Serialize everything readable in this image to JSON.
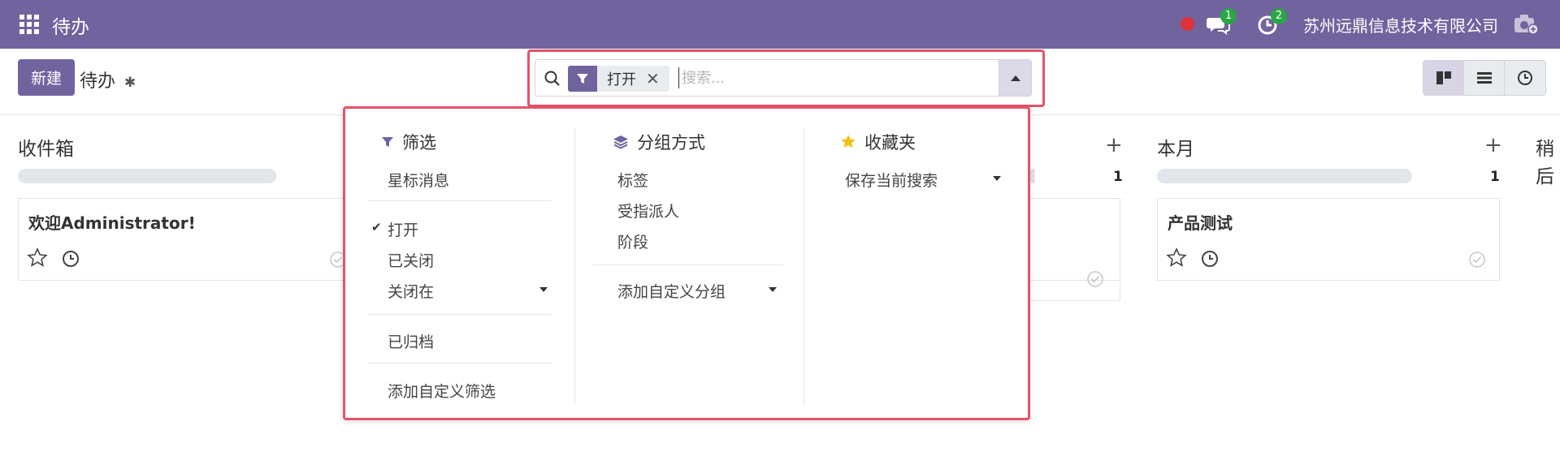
{
  "navbar": {
    "app_title": "待办",
    "chat_badge": "1",
    "activity_badge": "2",
    "company": "苏州远鼎信息技术有限公司",
    "bg_color": "#71639e"
  },
  "control": {
    "new_label": "新建",
    "breadcrumb": "待办"
  },
  "search": {
    "facet_label": "打开",
    "placeholder": "搜索..."
  },
  "dropdown": {
    "filter": {
      "title": "筛选",
      "items": [
        "星标消息",
        "打开",
        "已关闭",
        "关闭在",
        "已归档",
        "添加自定义筛选"
      ],
      "checked": "打开"
    },
    "groupby": {
      "title": "分组方式",
      "items": [
        "标签",
        "受指派人",
        "阶段",
        "添加自定义分组"
      ]
    },
    "favorites": {
      "title": "收藏夹",
      "items": [
        "保存当前搜索"
      ]
    }
  },
  "kanban": {
    "columns": [
      {
        "title": "收件箱",
        "count": "",
        "card": "欢迎Administrator!"
      },
      {
        "title": "",
        "count": "1",
        "card": ""
      },
      {
        "title": "本月",
        "count": "1",
        "card": "产品测试"
      },
      {
        "title": "稍后",
        "count": "",
        "card": ""
      }
    ]
  }
}
